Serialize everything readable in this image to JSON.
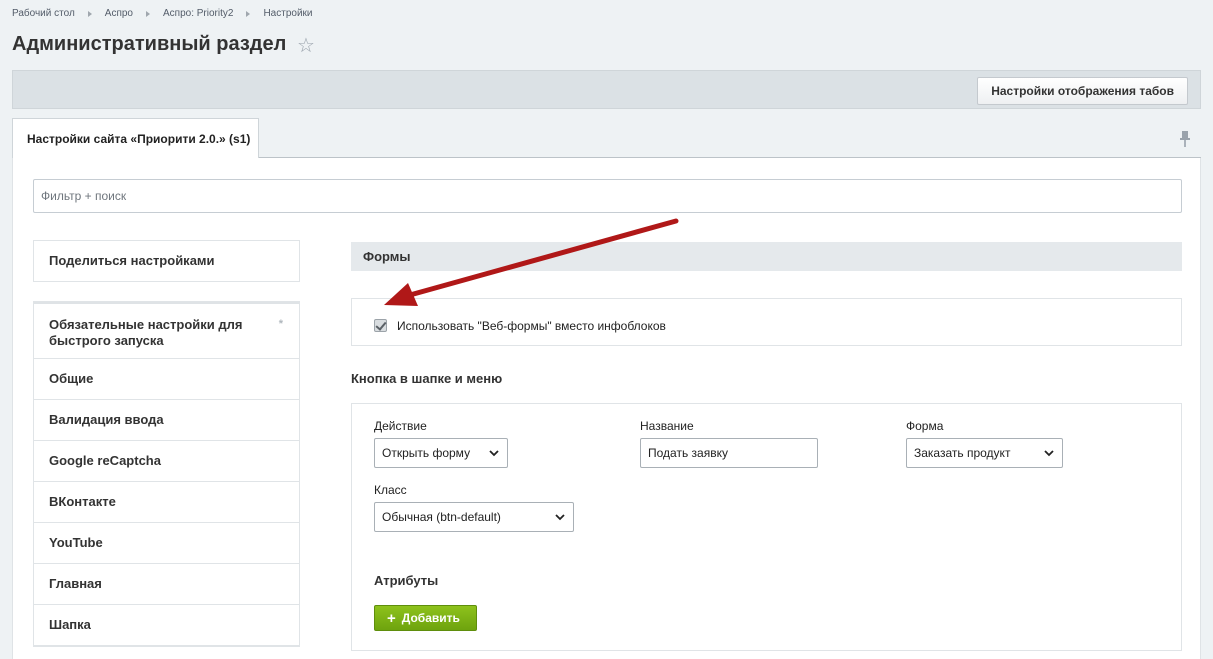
{
  "breadcrumb": [
    "Рабочий стол",
    "Аспро",
    "Аспро: Priority2",
    "Настройки"
  ],
  "page_title": "Административный раздел",
  "toolbar": {
    "tabs_settings_label": "Настройки отображения табов"
  },
  "tab": {
    "label": "Настройки сайта «Приорити 2.0.» (s1)"
  },
  "filter": {
    "placeholder": "Фильтр + поиск"
  },
  "sidebar": {
    "share_label": "Поделиться настройками",
    "items": [
      "Обязательные настройки для быстрого запуска",
      "Общие",
      "Валидация ввода",
      "Google reCaptcha",
      "ВКонтакте",
      "YouTube",
      "Главная",
      "Шапка"
    ],
    "required_mark": "*"
  },
  "section": {
    "title": "Формы",
    "checkbox_label": "Использовать \"Веб-формы\" вместо инфоблоков",
    "checkbox_checked": true,
    "subsection_title": "Кнопка в шапке и меню",
    "fields": {
      "action_label": "Действие",
      "action_value": "Открыть форму",
      "name_label": "Название",
      "name_value": "Подать заявку",
      "form_label": "Форма",
      "form_value": "Заказать продукт",
      "class_label": "Класс",
      "class_value": "Обычная (btn-default)"
    },
    "attributes_title": "Атрибуты",
    "add_button_label": "Добавить"
  },
  "colors": {
    "accent_green": "#7ab317",
    "annotation_arrow": "#b01818"
  }
}
